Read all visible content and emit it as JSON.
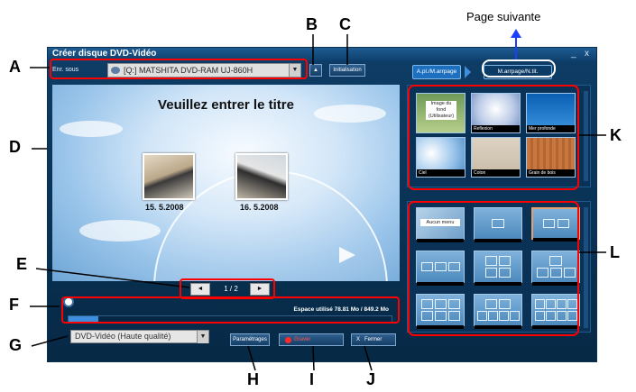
{
  "window": {
    "title": "Créer disque DVD-Vidéo",
    "minimize": "_",
    "close": "x"
  },
  "drive": {
    "label": "Enr. sous",
    "value": "[Q:] MATSHITA DVD-RAM UJ-860H"
  },
  "toolbar": {
    "eject_icon": "eject-icon",
    "init_label": "Initialisation"
  },
  "tabs": [
    {
      "label": "A.pl./M.arrpage"
    },
    {
      "label": "M.arrpage/N.tit."
    }
  ],
  "preview": {
    "menu_title": "Veuillez entrer le titre",
    "thumbs": [
      {
        "caption": "15. 5.2008"
      },
      {
        "caption": "16. 5.2008"
      }
    ],
    "page": "1 / 2"
  },
  "space": {
    "text": "Espace utilisé  78.81 Mo / 849.2 Mo",
    "used_fraction": 0.093
  },
  "format": {
    "value": "DVD-Vidéo (Haute qualité)"
  },
  "buttons": {
    "settings": "Paramétrages",
    "burn": "Graver",
    "close": "Fermer"
  },
  "backgrounds": [
    {
      "label": "Image du fond (Utilisateur)"
    },
    {
      "label": "Reflexion"
    },
    {
      "label": "Mer profonde"
    },
    {
      "label": "Ciel"
    },
    {
      "label": "Coton"
    },
    {
      "label": "Grain de bois"
    }
  ],
  "layouts": [
    {
      "label": "Aucun menu"
    }
  ],
  "annotations": {
    "A": "A",
    "B": "B",
    "C": "C",
    "D": "D",
    "E": "E",
    "F": "F",
    "G": "G",
    "H": "H",
    "I": "I",
    "J": "J",
    "K": "K",
    "L": "L",
    "next_page": "Page suivante"
  },
  "colors": {
    "accent": "#ff0000",
    "window_bg": "#0b355a",
    "progress": "#3f8ede"
  }
}
